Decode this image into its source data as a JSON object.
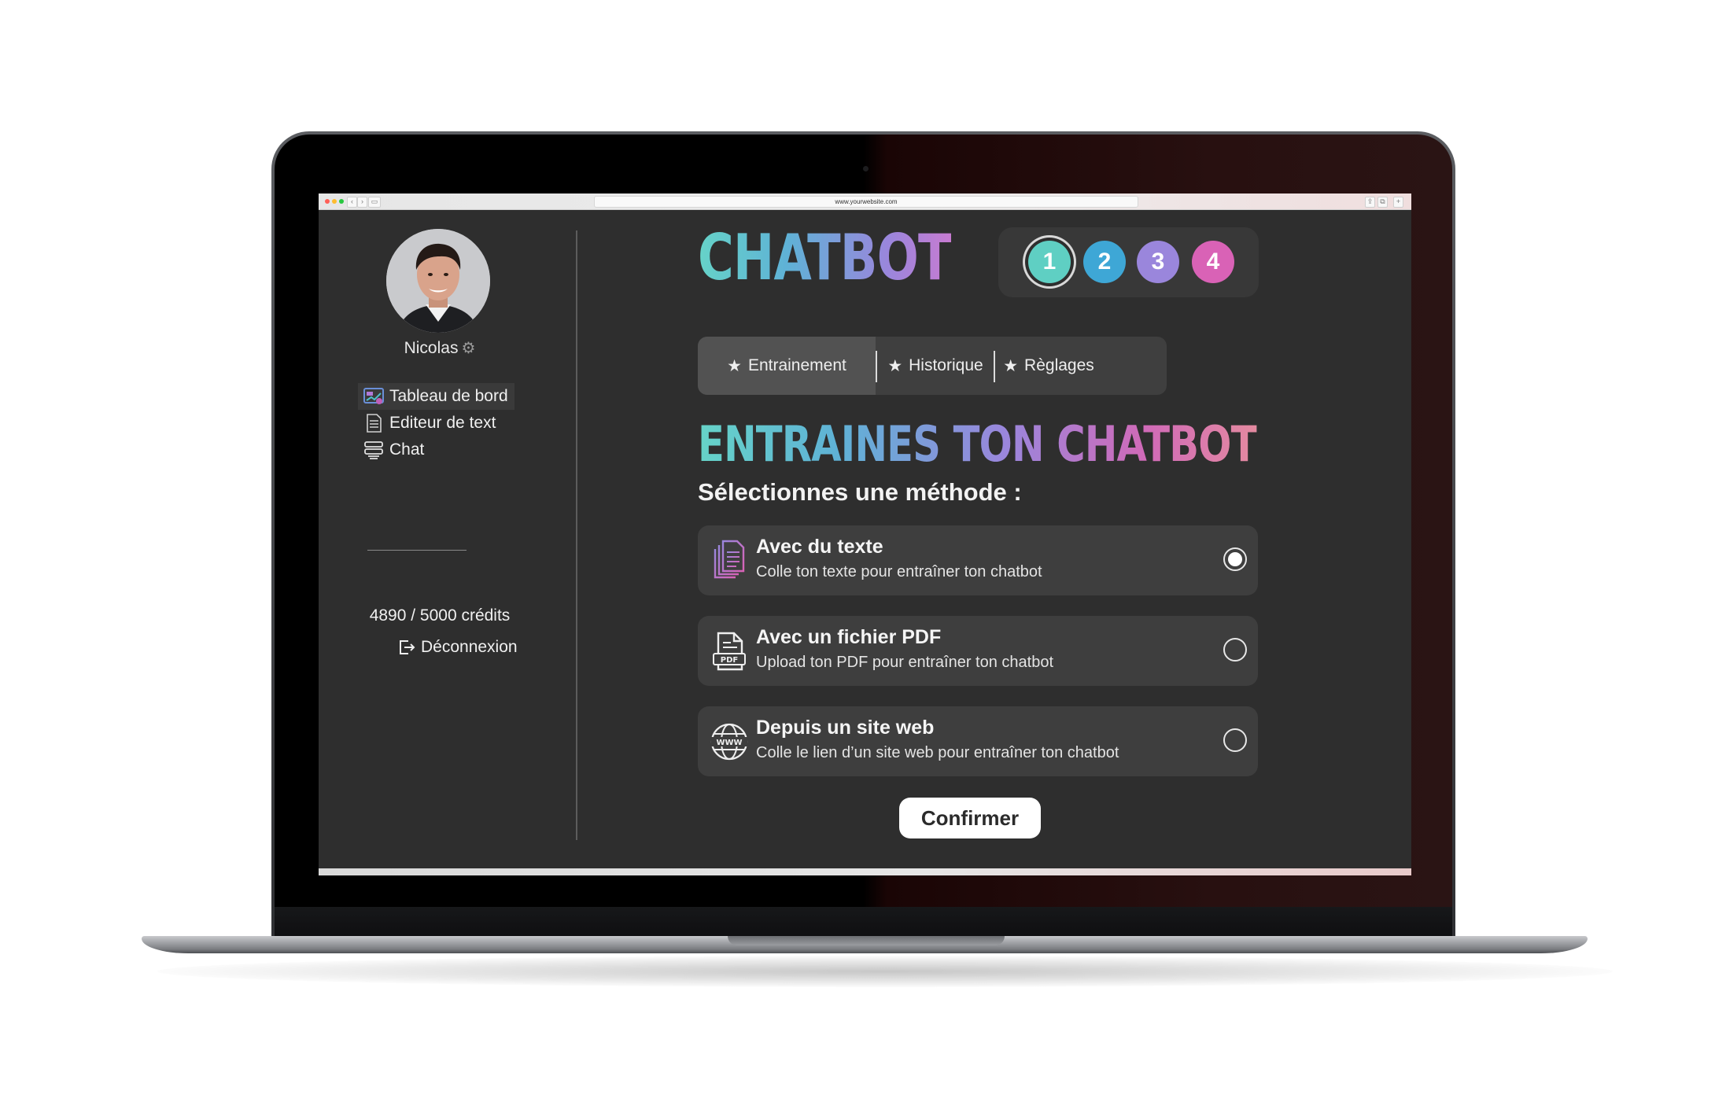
{
  "browser": {
    "url": "www.yourwebsite.com"
  },
  "sidebar": {
    "username": "Nicolas",
    "items": [
      {
        "label": "Tableau de bord",
        "icon": "dashboard-icon",
        "active": true
      },
      {
        "label": "Editeur de text",
        "icon": "document-icon",
        "active": false
      },
      {
        "label": "Chat",
        "icon": "chat-icon",
        "active": false
      }
    ],
    "credits": "4890 / 5000 crédits",
    "logout_label": "Déconnexion"
  },
  "main": {
    "brand": "CHATBOT",
    "steps": [
      "1",
      "2",
      "3",
      "4"
    ],
    "active_step": "1",
    "tabs": [
      {
        "label": "Entrainement",
        "active": true
      },
      {
        "label": "Historique",
        "active": false
      },
      {
        "label": "Règlages",
        "active": false
      }
    ],
    "heading": "ENTRAINES TON CHATBOT",
    "subheading": "Sélectionnes une méthode :",
    "options": [
      {
        "title": "Avec du texte",
        "description": "Colle ton texte pour entraîner ton chatbot",
        "icon": "text-documents-icon",
        "selected": true
      },
      {
        "title": "Avec un fichier PDF",
        "description": "Upload ton PDF pour entraîner ton chatbot",
        "icon": "pdf-file-icon",
        "selected": false
      },
      {
        "title": "Depuis un site web",
        "description": "Colle le lien d’un site web pour entraîner ton chatbot",
        "icon": "www-globe-icon",
        "selected": false
      }
    ],
    "confirm_label": "Confirmer"
  },
  "colors": {
    "background": "#2e2e2e",
    "panel": "#3e3e3e",
    "accent_teal": "#5fcfc3",
    "accent_blue": "#3ea7d6",
    "accent_purple": "#9a86dc",
    "accent_pink": "#d962b6"
  }
}
